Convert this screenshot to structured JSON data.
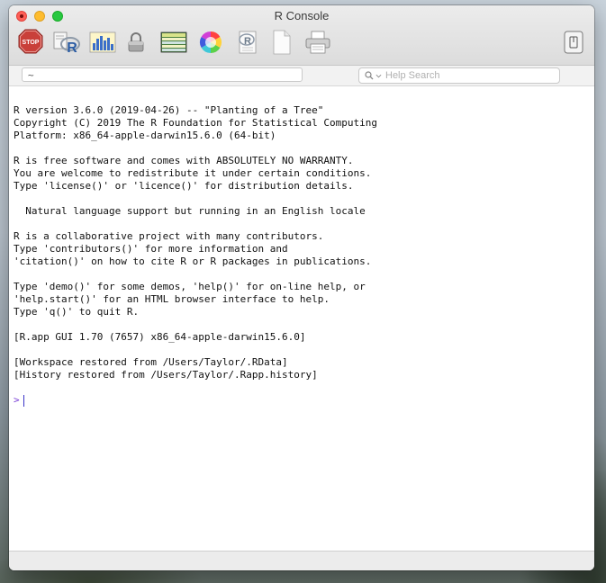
{
  "window": {
    "title": "R Console"
  },
  "toolbar": {
    "stop_label": "STOP",
    "icons": [
      "stop-icon",
      "source-r-script-icon",
      "quartz-chart-icon",
      "lock-icon",
      "workspace-browser-icon",
      "color-wheel-icon",
      "r-help-icon",
      "new-document-icon",
      "print-icon",
      "toggle-drawer-icon"
    ]
  },
  "path_bar": {
    "value": "~"
  },
  "search": {
    "placeholder": "Help Search"
  },
  "console": {
    "lines": [
      "R version 3.6.0 (2019-04-26) -- \"Planting of a Tree\"",
      "Copyright (C) 2019 The R Foundation for Statistical Computing",
      "Platform: x86_64-apple-darwin15.6.0 (64-bit)",
      "",
      "R is free software and comes with ABSOLUTELY NO WARRANTY.",
      "You are welcome to redistribute it under certain conditions.",
      "Type 'license()' or 'licence()' for distribution details.",
      "",
      "  Natural language support but running in an English locale",
      "",
      "R is a collaborative project with many contributors.",
      "Type 'contributors()' for more information and",
      "'citation()' on how to cite R or R packages in publications.",
      "",
      "Type 'demo()' for some demos, 'help()' for on-line help, or",
      "'help.start()' for an HTML browser interface to help.",
      "Type 'q()' to quit R.",
      "",
      "[R.app GUI 1.70 (7657) x86_64-apple-darwin15.6.0]",
      "",
      "[Workspace restored from /Users/Taylor/.RData]",
      "[History restored from /Users/Taylor/.Rapp.history]"
    ],
    "prompt": ">"
  }
}
